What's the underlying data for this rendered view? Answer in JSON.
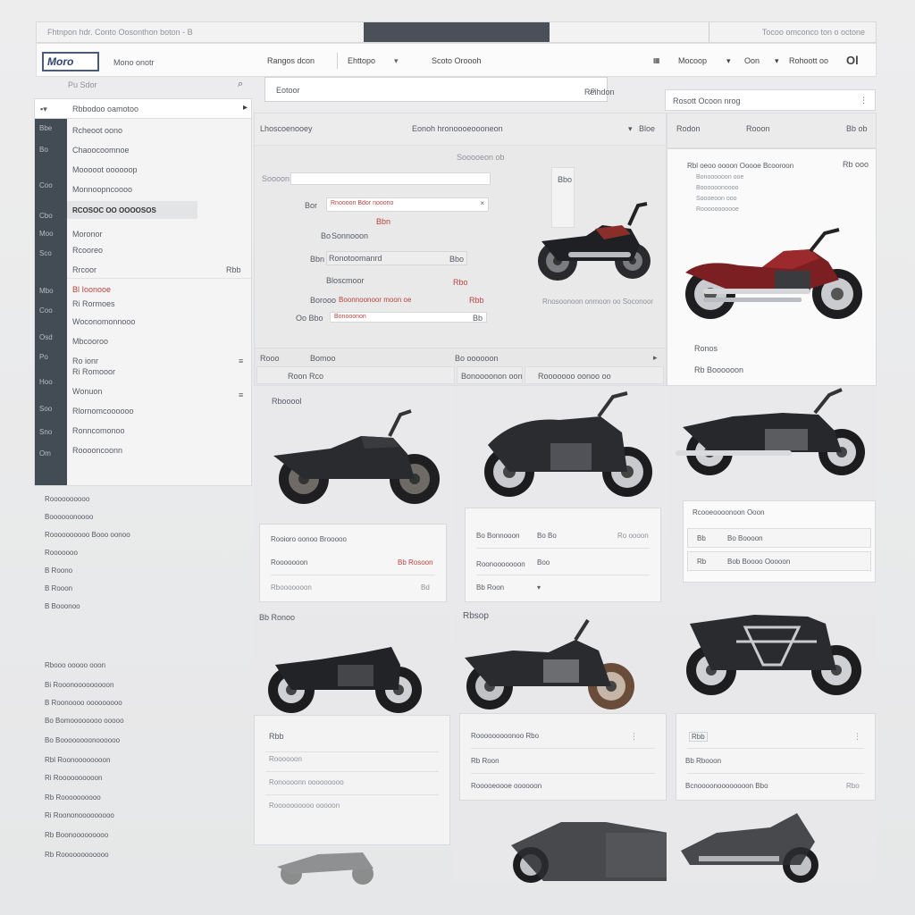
{
  "window": {
    "address_text": "Fhtnpon hdr. Conto Oosonthon boton - B",
    "right_text": "Tocoo omconco ton o octone"
  },
  "header": {
    "logo_text": "Moro",
    "brand_tag": "Mono onotr",
    "nav": [
      "Rangos dcon",
      "Ehttopo",
      "Scoto Oroooh",
      "Mocoop",
      "Oon",
      "Rohoott oo",
      "Ol"
    ]
  },
  "search": {
    "sidebar_placeholder": "Pu Sdor",
    "main_value": "Eotoor",
    "filter_label": "Reihdon",
    "sort_label": "Rosott Ocoon nrog"
  },
  "sidebar": {
    "header_label": "Rbbodoo oamotoo",
    "items": [
      "Rcheoot oono",
      "Chaoocoomnoe",
      "Mooooot oooooop",
      "Monnoopncoooo",
      "RCOSOC OO OOOOSOS",
      "Moronor",
      "Rcooreo",
      "Rrcoor",
      "Bl Ioonooe",
      "Ri Rormoes",
      "Woconomonnooo",
      "Mbcooroo",
      "Ro ionr",
      "Ri Romooor",
      "Wonuon",
      "Rlornomcoooooo",
      "Ronncomonoo",
      "Rooooncoonn"
    ],
    "rail_icons": [
      "Bbe",
      "Bo",
      "Coo",
      "Cbo",
      "Moo",
      "Sco",
      "Mbo",
      "Coo",
      "Osd",
      "Po",
      "Hoo",
      "Soo",
      "Sno",
      "Om"
    ],
    "small_values": [
      "Bb",
      "Rbb"
    ]
  },
  "listing": {
    "title": "Lhoscoenooey",
    "subtitle": "Eonoh hronoooeoooneon",
    "badge": "Bloe",
    "center_label": "Sooooeon ob",
    "rows": [
      {
        "a": "Soooon",
        "b": "",
        "c": ""
      },
      {
        "a": "Bor",
        "b": "Rnoooon Bdor nooono",
        "c": "Bbn"
      },
      {
        "a": "Bo",
        "b": "Sonnooon",
        "c": ""
      },
      {
        "a": "Bbn",
        "b": "Ronotoomanrd",
        "c": "Bbo"
      },
      {
        "a": "",
        "b": "Bloscmoor",
        "c": "Rbo"
      },
      {
        "a": "Borooo",
        "b": "Boonnoonoor moon oe",
        "c": "Rbb"
      },
      {
        "a": "Oo Bbo",
        "b": "Bonooonon",
        "c": "Bb"
      }
    ],
    "bottom_left": "Rooo",
    "bottom_mid": "Bomoo",
    "bottom_right": "Bo oooooon",
    "bottom_cells": [
      "Roon Rco",
      "Bonoooonon oon",
      "Rooooooo oonoo oo"
    ],
    "image_caption": "Rnosoonoon onmoon oo Soconoor",
    "thumb_label": "Bbo"
  },
  "featured": {
    "top_labels": [
      "Rodon",
      "Rooon",
      "Bb ob"
    ],
    "title": "Rbl oeoo oooon Ooooe Bcooroon",
    "price": "Rb ooo",
    "specs": [
      "Bonoooooon ooe",
      "Boooooonoooo",
      "Soooeoon ooo",
      "Rooooooooooe"
    ],
    "footer": [
      "Ronos",
      "Rb Boooooon"
    ]
  },
  "products": [
    {
      "label": "Rbooool",
      "card_title": "Rooioro oonoo Brooooo",
      "card_line1": "Rooooooon",
      "card_price": "Bb Rosoon",
      "card_line2": "Rbooooooon",
      "card_meta": "Bd"
    },
    {
      "label": "",
      "card_title": "Bo Bonnooon",
      "card_price": "Bo Bo",
      "card_line1": "Roonooooooon",
      "card_meta": "Boo",
      "card_line2": "Bb Roon",
      "card_value": "Ro oooon"
    },
    {
      "label": "",
      "card_title": "Rcooeoooonoon Ooon",
      "rows": [
        {
          "a": "Bb",
          "b": "Bo Boooon"
        },
        {
          "a": "Rb",
          "b": "Bob Boooo Ooooon"
        }
      ]
    },
    {
      "label": "Bb Ronoo",
      "card_title": "Rbb",
      "card_line1": "Roooooon",
      "card_line2": "Ronoooonn ooooooooo",
      "card_line3": "Roooooooooo ooooon"
    },
    {
      "label": "Rbsop",
      "card_title": "Rooooooooonoo Rbo",
      "card_line1": "Rb Roon",
      "card_line2": "Rooooeoooe oooooon"
    },
    {
      "label": "",
      "card_title": "Rbb",
      "card_line1": "Bb Rbooon",
      "card_line2": "Bcnoooonoooooooon Bbo",
      "card_value": "Rbo"
    }
  ],
  "footer_links": [
    "Roooooooooo",
    "Boooooonoooo",
    "Roooooooooo Booo oonoo",
    "Rooooooo",
    "B Roono",
    "B Rooon",
    "B Booonoo"
  ],
  "footer_links2": [
    "Rbooo ooooo ooon",
    "Bi Rooonooooooooon",
    "B Roonoooo ooooooooo",
    "Bo Bomoooooooo ooooo",
    "Bo Boooooooonoooooo",
    "Rbl Roonoooooooon",
    "Ri Roooooooooon",
    "Rb Roooooooooo",
    "Ri Roononooooooooo",
    "Rb Boonooooooooo",
    "Rb Roooooooooooo"
  ]
}
